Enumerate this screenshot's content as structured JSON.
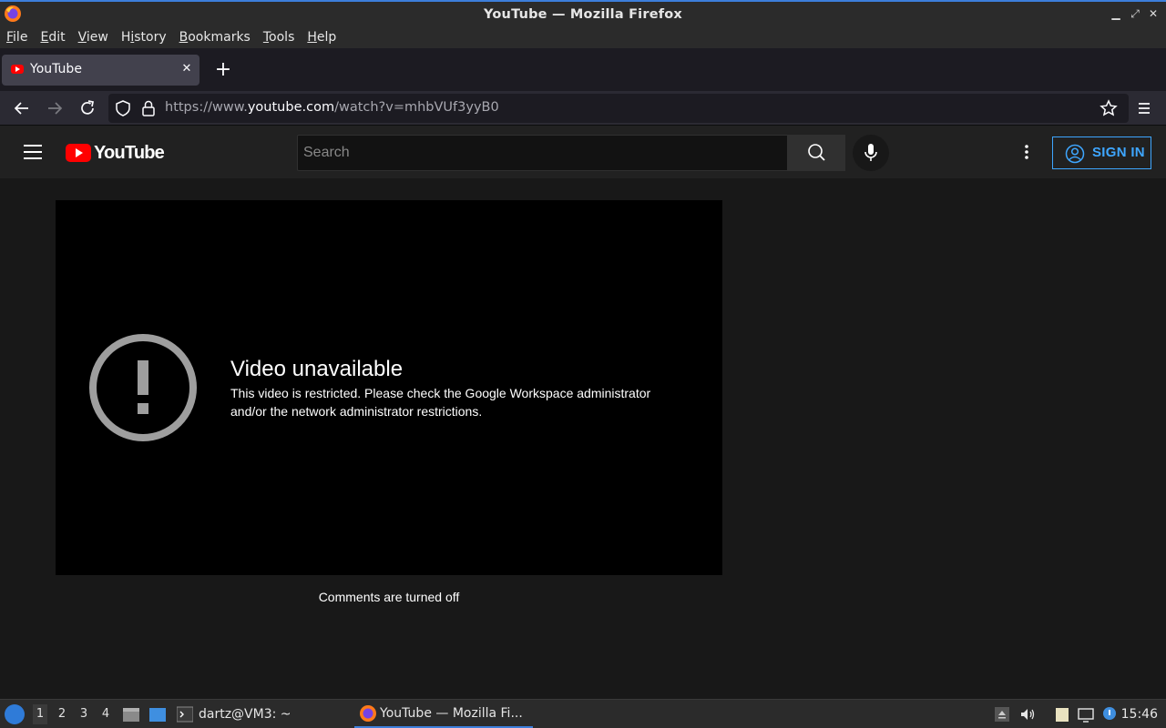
{
  "window": {
    "title": "YouTube — Mozilla Firefox"
  },
  "menubar": {
    "items": [
      {
        "label": "File",
        "ul": "F",
        "rest": "ile"
      },
      {
        "label": "Edit",
        "ul": "E",
        "rest": "dit"
      },
      {
        "label": "View",
        "ul": "V",
        "rest": "iew"
      },
      {
        "label": "History",
        "ul": "H",
        "rest": "istory",
        "pre": ""
      },
      {
        "label": "Bookmarks",
        "ul": "B",
        "rest": "ookmarks"
      },
      {
        "label": "Tools",
        "ul": "T",
        "rest": "ools"
      },
      {
        "label": "Help",
        "ul": "H",
        "rest": "elp"
      }
    ]
  },
  "tabs": {
    "active_label": "YouTube"
  },
  "urlbar": {
    "prefix": "https://www.",
    "host": "youtube.com",
    "path": "/watch?v=mhbVUf3yyB0"
  },
  "youtube": {
    "logo_text": "YouTube",
    "search_placeholder": "Search",
    "signin_label": "SIGN IN",
    "error_title": "Video unavailable",
    "error_message": "This video is restricted. Please check the Google Workspace administrator and/or the network administrator restrictions.",
    "comments_status": "Comments are turned off"
  },
  "taskbar": {
    "workspaces": [
      "1",
      "2",
      "3",
      "4"
    ],
    "terminal_task": "dartz@VM3: ~",
    "browser_task": "YouTube — Mozilla Fi...",
    "clock": "15:46"
  },
  "colors": {
    "youtube_red": "#ff0000",
    "signin_blue": "#3ea6ff",
    "accent": "#3d7edb"
  }
}
